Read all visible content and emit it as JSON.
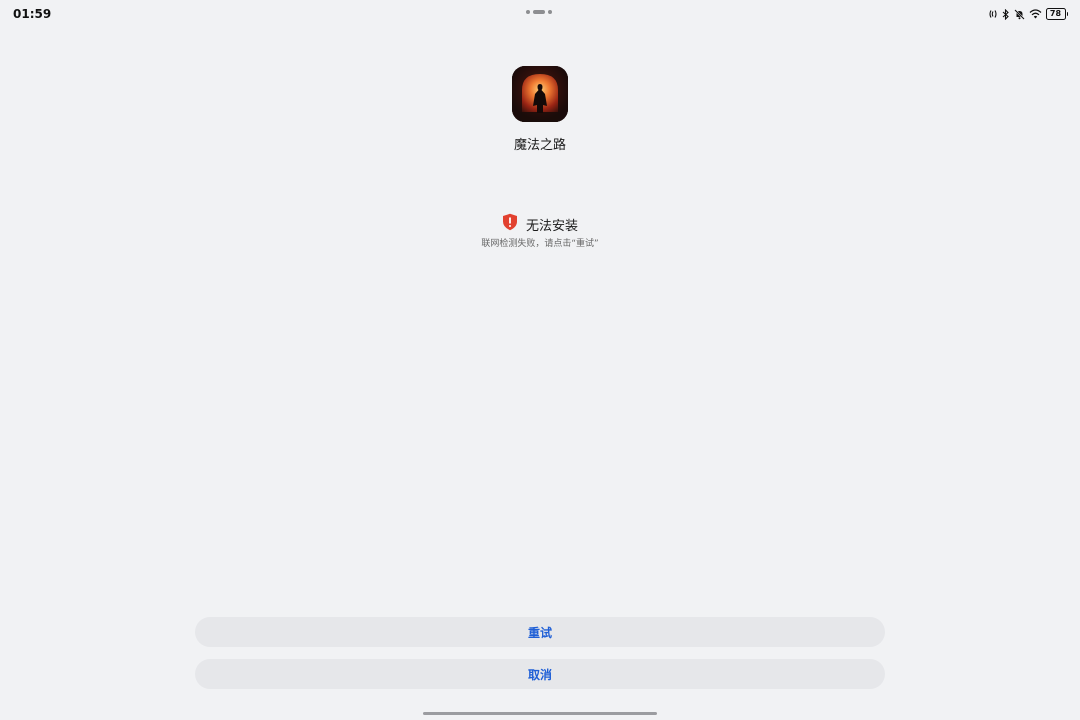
{
  "status_bar": {
    "time": "01:59",
    "battery_level": "78",
    "icons": [
      "nfc-icon",
      "bluetooth-icon",
      "bell-off-icon",
      "wifi-icon",
      "battery-icon"
    ]
  },
  "app": {
    "name": "魔法之路",
    "icon": "app-icon"
  },
  "error": {
    "icon": "shield-alert-icon",
    "title": "无法安装",
    "description": "联网检测失败，请点击“重试”",
    "color": "#e2412f"
  },
  "actions": {
    "retry_label": "重试",
    "cancel_label": "取消",
    "accent": "#1f5fd6"
  }
}
